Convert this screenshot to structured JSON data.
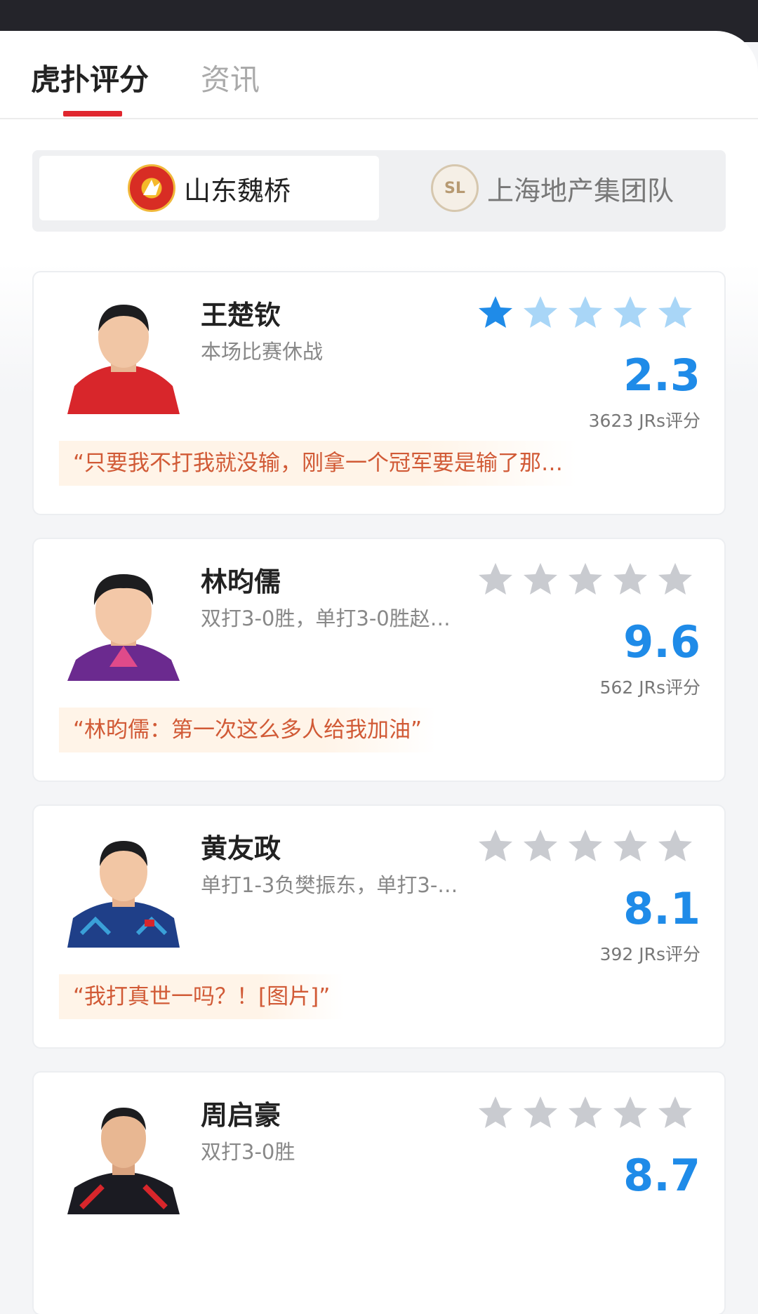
{
  "tabs": [
    {
      "label": "虎扑评分",
      "active": true
    },
    {
      "label": "资讯",
      "active": false
    }
  ],
  "teams": [
    {
      "name": "山东魏桥",
      "logo_icon": "shandong-weiqiao-logo",
      "selected": true
    },
    {
      "name": "上海地产集团队",
      "logo_icon": "shanghai-sl-logo",
      "logo_text": "SL",
      "selected": false
    }
  ],
  "players": [
    {
      "name": "王楚钦",
      "desc": "本场比赛休战",
      "score": "2.3",
      "votes": "3623 JRs评分",
      "quote": "“只要我不打我就没输，刚拿一个冠军要是输了那…",
      "stars_filled": 1,
      "jersey_color": "#d8262b"
    },
    {
      "name": "林昀儒",
      "desc": "双打3-0胜，单打3-0胜赵…",
      "score": "9.6",
      "votes": "562 JRs评分",
      "quote": "“林昀儒：第一次这么多人给我加油”",
      "stars_filled": 0,
      "jersey_color": "#6b2a8f"
    },
    {
      "name": "黄友政",
      "desc": "单打1-3负樊振东，单打3-…",
      "score": "8.1",
      "votes": "392 JRs评分",
      "quote": "“我打真世一吗？！[图片]”",
      "stars_filled": 0,
      "jersey_color": "#1f3f88"
    },
    {
      "name": "周启豪",
      "desc": "双打3-0胜",
      "score": "8.7",
      "votes": "",
      "quote": "",
      "stars_filled": 0,
      "jersey_color": "#1b1b22"
    }
  ],
  "colors": {
    "accent_red": "#e0262e",
    "score_blue": "#1f8be8",
    "star_filled": "#1f8be8",
    "star_light": "#a9d6f7",
    "star_gray": "#c9cbd0"
  }
}
